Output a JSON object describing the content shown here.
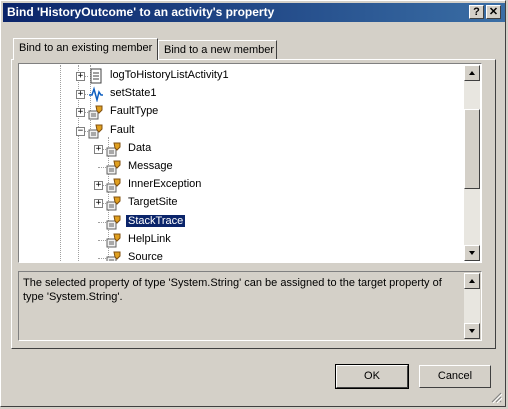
{
  "window": {
    "title": "Bind 'HistoryOutcome' to an activity's property",
    "help_button": "?",
    "close_button": "✕"
  },
  "tabs": [
    {
      "label": "Bind to an existing member",
      "active": true
    },
    {
      "label": "Bind to a new member",
      "active": false
    }
  ],
  "tree": {
    "items": [
      {
        "label": "logToHistoryListActivity1",
        "icon": "activity-page-icon",
        "expander": "+",
        "selected": false
      },
      {
        "label": "setState1",
        "icon": "state-wave-icon",
        "expander": "+",
        "selected": false
      },
      {
        "label": "FaultType",
        "icon": "property-icon",
        "expander": "+",
        "selected": false
      },
      {
        "label": "Fault",
        "icon": "property-icon",
        "expander": "-",
        "selected": false
      },
      {
        "label": "Data",
        "icon": "property-icon",
        "expander": "+",
        "selected": false
      },
      {
        "label": "Message",
        "icon": "property-icon",
        "expander": "",
        "selected": false
      },
      {
        "label": "InnerException",
        "icon": "property-icon",
        "expander": "+",
        "selected": false
      },
      {
        "label": "TargetSite",
        "icon": "property-icon",
        "expander": "+",
        "selected": false
      },
      {
        "label": "StackTrace",
        "icon": "property-icon",
        "expander": "",
        "selected": true
      },
      {
        "label": "HelpLink",
        "icon": "property-icon",
        "expander": "",
        "selected": false
      },
      {
        "label": "Source",
        "icon": "property-icon",
        "expander": "",
        "selected": false
      }
    ]
  },
  "description": {
    "text": "The selected property of type 'System.String' can be assigned to the target property of type 'System.String'."
  },
  "buttons": {
    "ok": "OK",
    "cancel": "Cancel"
  },
  "colors": {
    "titlebar_start": "#0a246a",
    "titlebar_end": "#3a6ea5",
    "selection": "#0a246a",
    "face": "#d4d0c8"
  }
}
